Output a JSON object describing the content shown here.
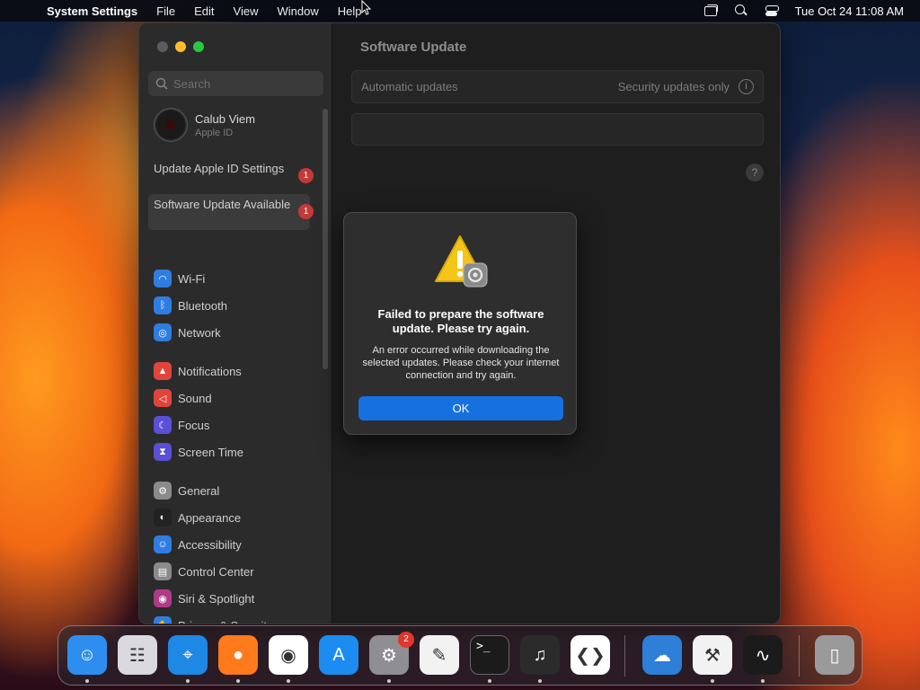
{
  "menubar": {
    "apple_icon": "",
    "app_name": "System Settings",
    "menus": [
      "File",
      "Edit",
      "View",
      "Window",
      "Help"
    ],
    "clock": "Tue Oct 24  11:08 AM"
  },
  "sidebar": {
    "search_placeholder": "Search",
    "profile": {
      "name": "Calub Viem",
      "sub": "Apple ID"
    },
    "alerts": [
      {
        "label": "Update Apple ID Settings",
        "badge": "1"
      },
      {
        "label": "Software Update Available",
        "badge": "1"
      }
    ],
    "items": [
      {
        "label": "Wi-Fi",
        "icon": "wifi-icon",
        "color": "#2f7de1"
      },
      {
        "label": "Bluetooth",
        "icon": "bluetooth-icon",
        "color": "#2f7de1"
      },
      {
        "label": "Network",
        "icon": "globe-icon",
        "color": "#2f7de1"
      },
      {
        "label": "Notifications",
        "icon": "bell-icon",
        "color": "#e0453c"
      },
      {
        "label": "Sound",
        "icon": "speaker-icon",
        "color": "#e0453c"
      },
      {
        "label": "Focus",
        "icon": "moon-icon",
        "color": "#5b4fd6"
      },
      {
        "label": "Screen Time",
        "icon": "hourglass-icon",
        "color": "#5b4fd6"
      },
      {
        "label": "General",
        "icon": "gear-icon",
        "color": "#8a8a8a"
      },
      {
        "label": "Appearance",
        "icon": "appearance-icon",
        "color": "#222222"
      },
      {
        "label": "Accessibility",
        "icon": "accessibility-icon",
        "color": "#2f7de1"
      },
      {
        "label": "Control Center",
        "icon": "control-center-icon",
        "color": "#8a8a8a"
      },
      {
        "label": "Siri & Spotlight",
        "icon": "siri-icon",
        "color": "#b03a8a"
      },
      {
        "label": "Privacy & Security",
        "icon": "hand-icon",
        "color": "#2f7de1"
      }
    ]
  },
  "main": {
    "title": "Software Update",
    "automatic_updates_label": "Automatic updates",
    "automatic_updates_value": "Security updates only",
    "info_glyph": "i",
    "help_glyph": "?"
  },
  "dialog": {
    "title": "Failed to prepare the software update. Please try again.",
    "message": "An error occurred while downloading the selected updates. Please check your internet connection and try again.",
    "ok_label": "OK"
  },
  "dock": {
    "apps": [
      {
        "name": "Finder",
        "icon": "finder-icon",
        "color": "#2d8ef0",
        "running": true
      },
      {
        "name": "Launchpad",
        "icon": "launchpad-icon",
        "color": "#d9d9df",
        "running": false
      },
      {
        "name": "Safari",
        "icon": "safari-icon",
        "color": "#1e88e5",
        "running": true
      },
      {
        "name": "Firefox",
        "icon": "firefox-icon",
        "color": "#ff7a1a",
        "running": true
      },
      {
        "name": "Chrome",
        "icon": "chrome-icon",
        "color": "#ffffff",
        "running": true
      },
      {
        "name": "App Store",
        "icon": "app-store-icon",
        "color": "#1c8cf0",
        "running": false
      },
      {
        "name": "System Settings",
        "icon": "settings-icon",
        "color": "#8e8e93",
        "running": true,
        "badge": "2"
      },
      {
        "name": "TextEdit",
        "icon": "textedit-icon",
        "color": "#f2f2f2",
        "running": false
      },
      {
        "name": "Terminal",
        "icon": "terminal-icon",
        "color": "#1b1b1b",
        "running": true
      },
      {
        "name": "GarageBand",
        "icon": "garageband-icon",
        "color": "#2b2b2b",
        "running": true
      },
      {
        "name": "Visual Studio Code",
        "icon": "vscode-icon",
        "color": "#ffffff",
        "running": false
      },
      {
        "name": "Weather",
        "icon": "weather-icon",
        "color": "#2d7fd8",
        "running": false
      },
      {
        "name": "System Information",
        "icon": "system-info-icon",
        "color": "#f2f2f2",
        "running": true
      },
      {
        "name": "Activity Monitor",
        "icon": "activity-monitor-icon",
        "color": "#1b1b1b",
        "running": true
      },
      {
        "name": "Trash",
        "icon": "trash-icon",
        "color": "#9a9a9a",
        "running": false
      }
    ],
    "terminal_glyph": ">_"
  }
}
